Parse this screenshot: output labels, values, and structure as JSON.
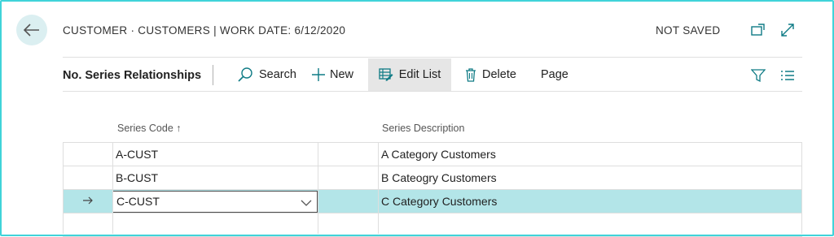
{
  "header": {
    "title": "CUSTOMER · CUSTOMERS | WORK DATE: 6/12/2020",
    "status": "NOT SAVED"
  },
  "toolbar": {
    "page_name": "No. Series Relationships",
    "search_label": "Search",
    "new_label": "New",
    "edit_list_label": "Edit List",
    "delete_label": "Delete",
    "page_label": "Page"
  },
  "table": {
    "columns": [
      "Series Code ↑",
      "Series Description"
    ],
    "rows": [
      {
        "code": "A-CUST",
        "description": "A Category Customers"
      },
      {
        "code": "B-CUST",
        "description": "B Cateogry Customers"
      },
      {
        "code": "C-CUST",
        "description": "C Category Customers"
      },
      {
        "code": "",
        "description": ""
      }
    ],
    "selected_row": 2
  },
  "colors": {
    "frame": "#3fd3d9",
    "selected_row": "#b3e5e8",
    "accent_icon": "#0f7b85"
  }
}
